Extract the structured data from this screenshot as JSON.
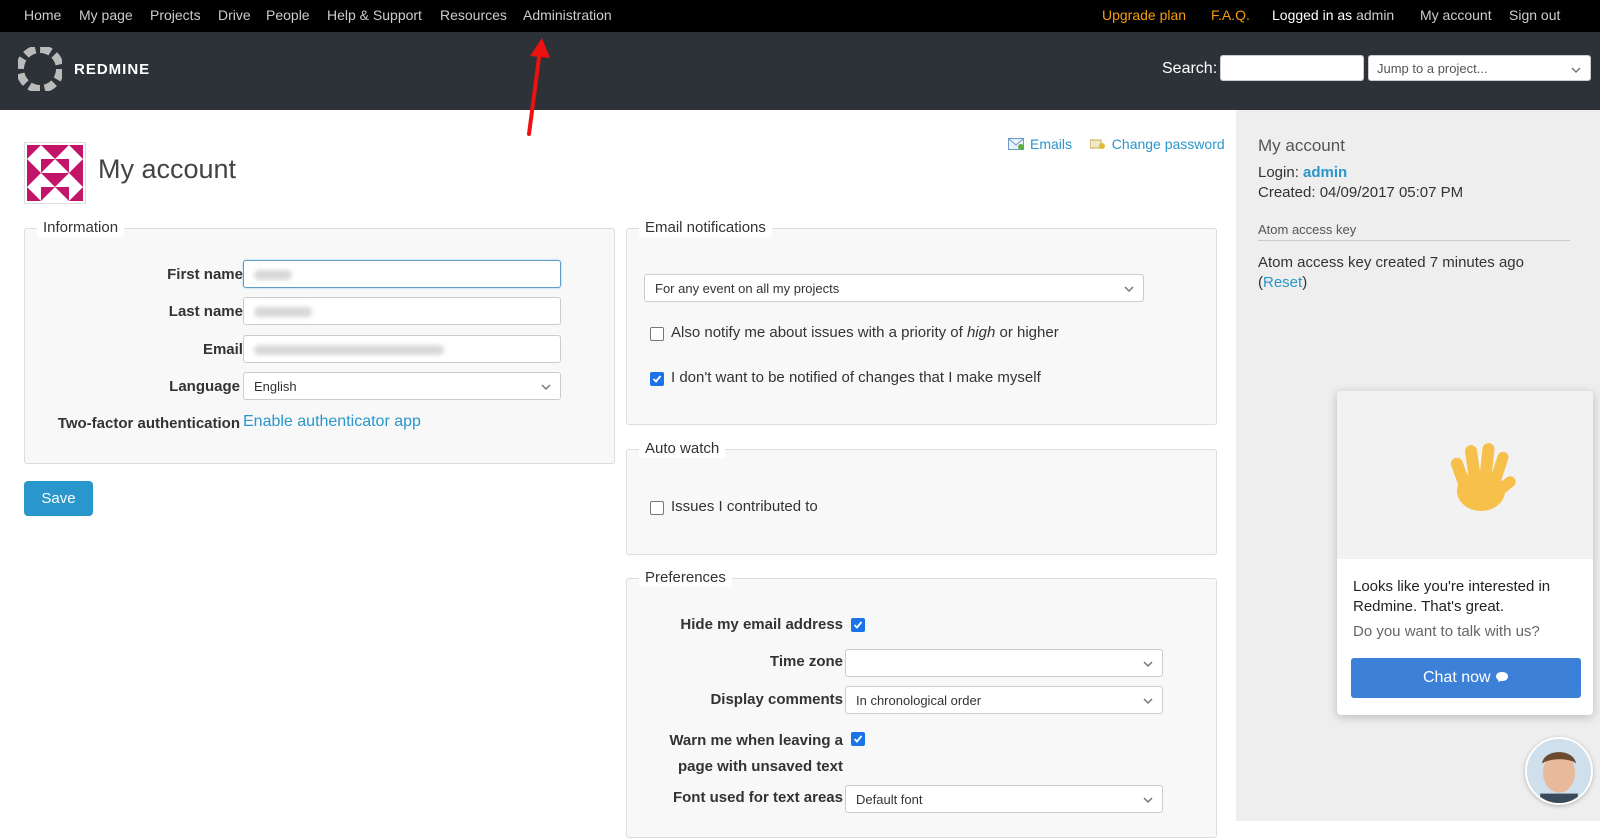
{
  "topnav": {
    "left": [
      "Home",
      "My page",
      "Projects",
      "Drive",
      "People",
      "Help & Support",
      "Resources",
      "Administration"
    ],
    "upgrade": "Upgrade plan",
    "faq": "F.A.Q.",
    "logged_in_as": "Logged in as",
    "user": "admin",
    "my_account": "My account",
    "sign_out": "Sign out"
  },
  "header": {
    "brand": "REDMINE",
    "search_label": "Search:",
    "jump_placeholder": "Jump to a project..."
  },
  "page": {
    "title": "My account",
    "emails_link": "Emails",
    "change_password_link": "Change password"
  },
  "information": {
    "legend": "Information",
    "first_name": "First name",
    "last_name": "Last name",
    "email": "Email",
    "required_mark": "*",
    "language": "Language",
    "language_value": "English",
    "two_factor": "Two-factor authentication",
    "two_factor_link": "Enable authenticator app"
  },
  "save_label": "Save",
  "email_notifications": {
    "legend": "Email notifications",
    "option": "For any event on all my projects",
    "notify_priority_pre": "Also notify me about issues with a priority of ",
    "notify_priority_em": "high",
    "notify_priority_post": " or higher",
    "no_self_notify": "I don't want to be notified of changes that I make myself"
  },
  "auto_watch": {
    "legend": "Auto watch",
    "issues_contributed": "Issues I contributed to"
  },
  "preferences": {
    "legend": "Preferences",
    "hide_email": "Hide my email address",
    "time_zone": "Time zone",
    "time_zone_value": "",
    "display_comments": "Display comments",
    "display_comments_value": "In chronological order",
    "warn_leaving_1": "Warn me when leaving a",
    "warn_leaving_2": "page with unsaved text",
    "font_text_areas": "Font used for text areas",
    "font_value": "Default font"
  },
  "sidebar": {
    "title": "My account",
    "login_label": "Login:",
    "login_value": "admin",
    "created": "Created: 04/09/2017 05:07 PM",
    "atom_title": "Atom access key",
    "atom_text": "Atom access key created 7 minutes ago",
    "reset_open": "(",
    "reset": "Reset",
    "reset_close": ")"
  },
  "chat": {
    "message": "Looks like you're interested in Redmine. That's great.",
    "question": "Do you want to talk with us?",
    "button": "Chat now"
  },
  "checkbox_states": {
    "notify_priority": false,
    "no_self_notify": true,
    "issues_contributed": false,
    "hide_email": true,
    "warn_leaving": true
  },
  "colors": {
    "topbar": "#000000",
    "header": "#2d3238",
    "accent": "#2996cc",
    "upgrade": "#f39c12",
    "annotation_arrow": "#ee1111"
  },
  "icons": [
    "redmine-logo-icon",
    "email-icon",
    "key-icon",
    "chevron-down-icon",
    "waving-hand-icon",
    "chat-bubble-icon",
    "red-arrow-icon"
  ]
}
